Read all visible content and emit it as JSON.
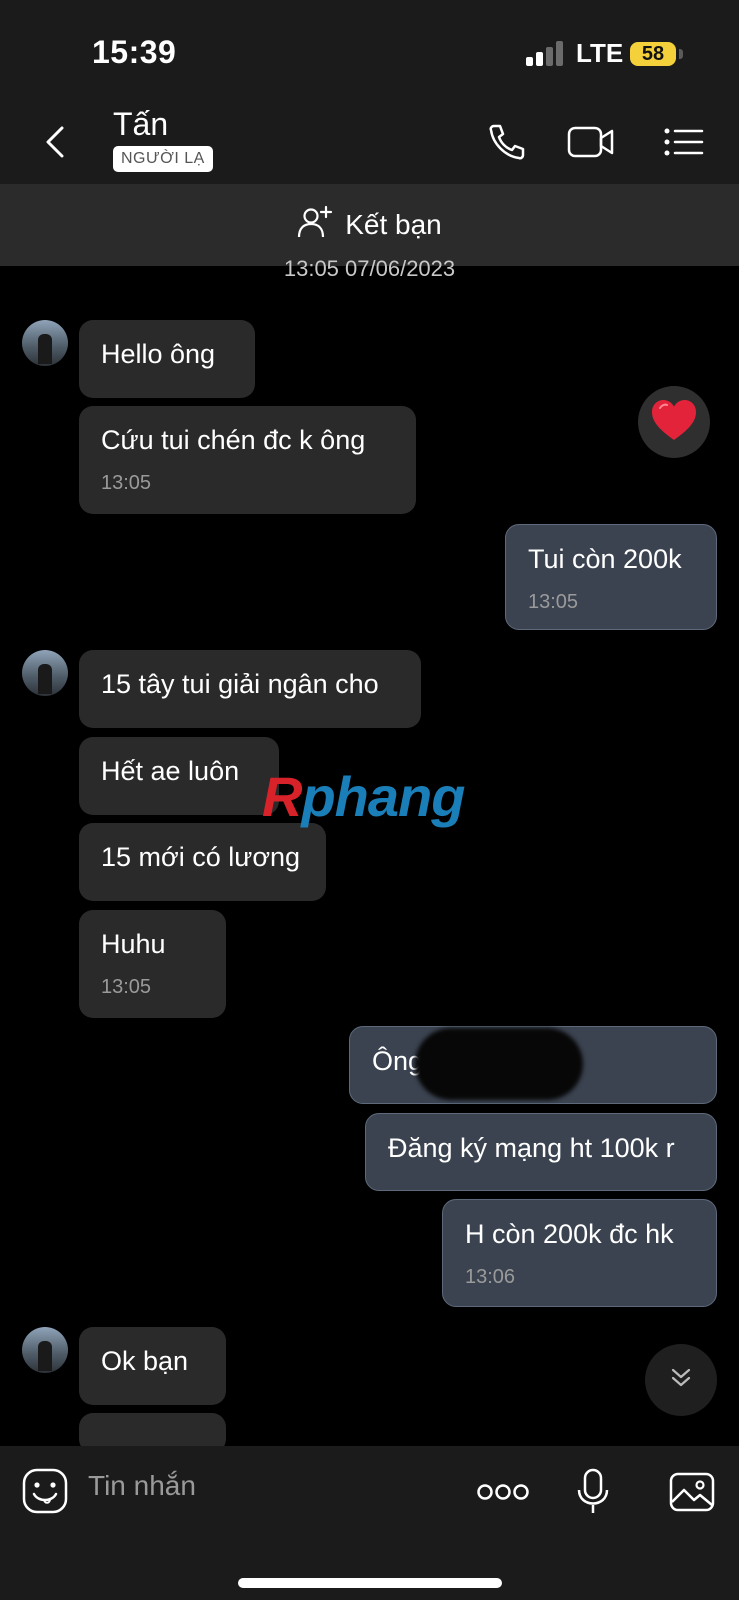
{
  "status_bar": {
    "time": "15:39",
    "network": "LTE",
    "battery": "58"
  },
  "header": {
    "name": "Tấn",
    "badge": "NGƯỜI LẠ"
  },
  "friend_bar": {
    "label": "Kết bạn"
  },
  "date_label": "13:05 07/06/2023",
  "messages": [
    {
      "dir": "in",
      "text": "Hello ông",
      "time": ""
    },
    {
      "dir": "in",
      "text": "Cứu tui chén đc k ông",
      "time": "13:05"
    },
    {
      "dir": "out",
      "text": "Tui còn 200k",
      "time": "13:05"
    },
    {
      "dir": "in",
      "text": "15 tây tui giải ngân cho",
      "time": ""
    },
    {
      "dir": "in",
      "text": "Hết ae luôn",
      "time": ""
    },
    {
      "dir": "in",
      "text": "15 mới có lương",
      "time": ""
    },
    {
      "dir": "in",
      "text": "Huhu",
      "time": "13:05"
    },
    {
      "dir": "out",
      "text": "Ông              ói giải 300k",
      "time": ""
    },
    {
      "dir": "out",
      "text": "Đăng ký mạng ht 100k r",
      "time": ""
    },
    {
      "dir": "out",
      "text": "H còn 200k đc hk",
      "time": "13:06"
    },
    {
      "dir": "in",
      "text": "Ok bạn",
      "time": ""
    }
  ],
  "watermark": {
    "r": "R",
    "rest": "phang"
  },
  "input": {
    "placeholder": "Tin nhắn"
  },
  "icons": [
    "back-icon",
    "phone-icon",
    "video-icon",
    "menu-icon",
    "add-friend-icon",
    "heart-icon",
    "chevron-down-icon",
    "emoji-icon",
    "more-icon",
    "microphone-icon",
    "image-icon"
  ],
  "colors": {
    "incoming": "#2a2a2a",
    "outgoing": "#3b4350",
    "background": "#000000"
  }
}
